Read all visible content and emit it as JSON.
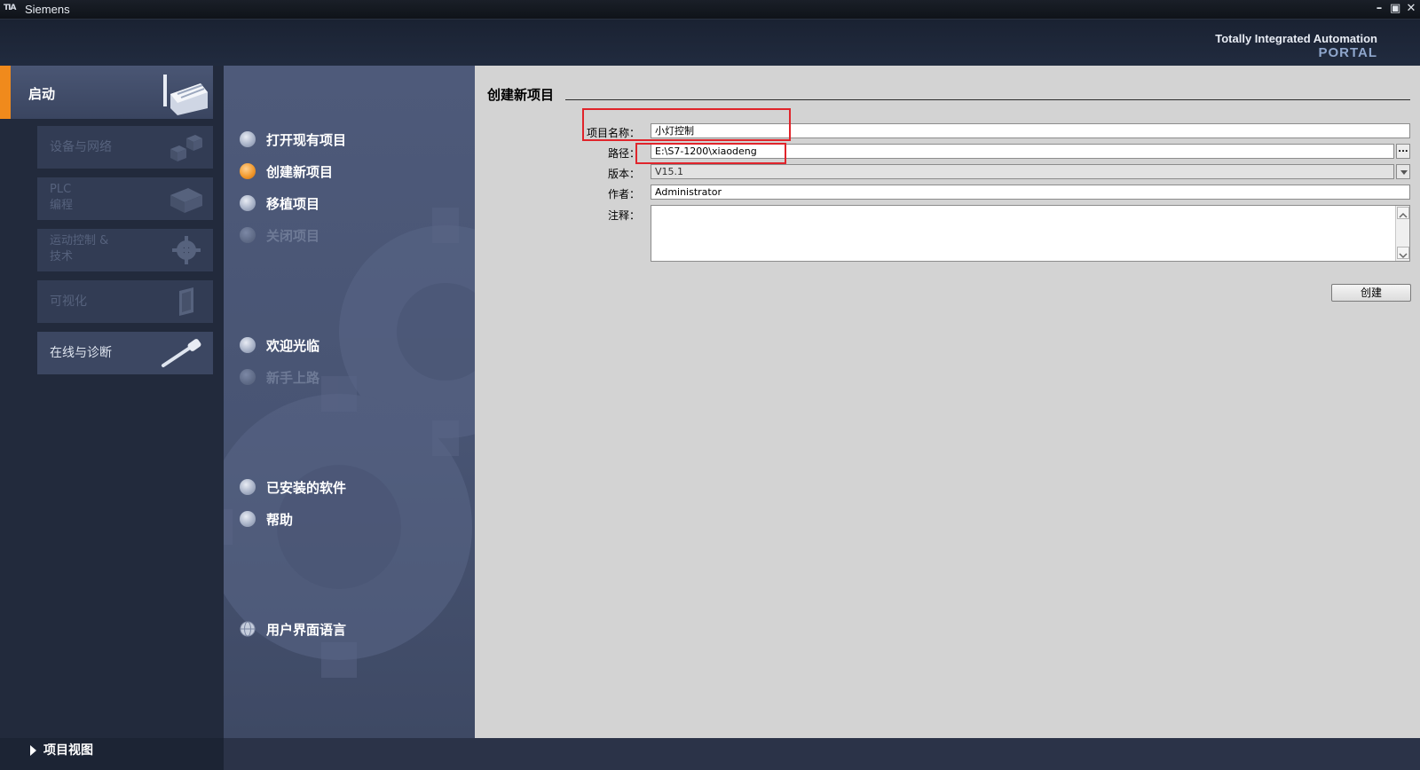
{
  "window": {
    "logo": "TIA",
    "title": "Siemens",
    "controls": [
      "–",
      "▣",
      "✕"
    ]
  },
  "header": {
    "brand_line1": "Totally Integrated Automation",
    "brand_line2": "PORTAL"
  },
  "left_nav": {
    "start": "启动",
    "items": [
      {
        "label": "设备与网络",
        "enabled": false,
        "icon": "network-devices-icon"
      },
      {
        "label": "PLC\n编程",
        "enabled": false,
        "icon": "plc-programming-icon"
      },
      {
        "label": "运动控制 &\n技术",
        "enabled": false,
        "icon": "motion-gear-icon"
      },
      {
        "label": "可视化",
        "enabled": false,
        "icon": "hmi-panel-icon"
      },
      {
        "label": "在线与诊断",
        "enabled": true,
        "icon": "diagnostics-tool-icon"
      }
    ],
    "project_view": "项目视图"
  },
  "actions": {
    "open_existing": "打开现有项目",
    "create_new": "创建新项目",
    "migrate": "移植项目",
    "close": "关闭项目",
    "welcome": "欢迎光临",
    "first_steps": "新手上路",
    "installed_software": "已安装的软件",
    "help": "帮助",
    "ui_language": "用户界面语言"
  },
  "form": {
    "title": "创建新项目",
    "project_name_label": "项目名称：",
    "project_name_value": "小灯控制",
    "path_label": "路径：",
    "path_value": "E:\\S7-1200\\xiaodeng",
    "browse_label": "...",
    "version_label": "版本：",
    "version_value": "V15.1",
    "author_label": "作者：",
    "author_value": "Administrator",
    "comment_label": "注释：",
    "comment_value": "",
    "create_button": "创建"
  },
  "colors": {
    "accent_orange": "#f08a1c",
    "highlight_red": "#e0242b",
    "content_bg": "#d3d3d3",
    "nav_bg": "#222a3c"
  }
}
